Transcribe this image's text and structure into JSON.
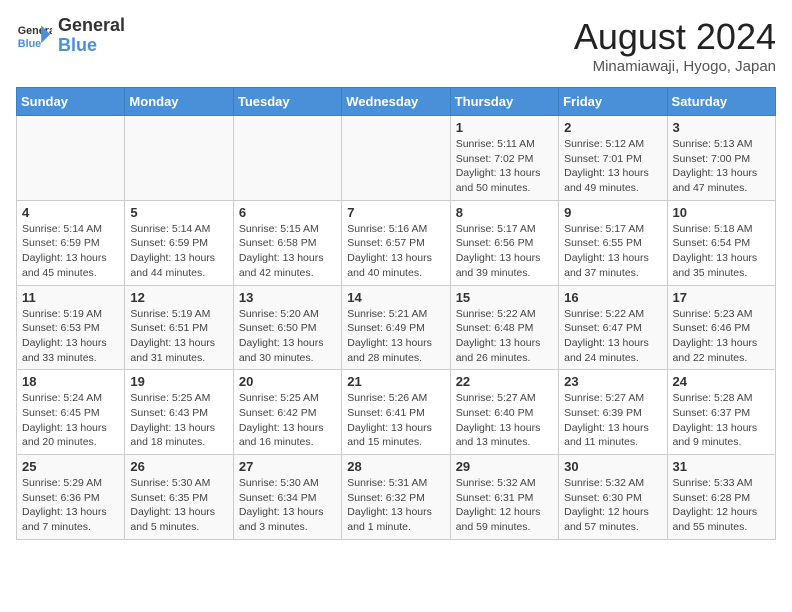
{
  "logo": {
    "line1": "General",
    "line2": "Blue"
  },
  "title": "August 2024",
  "subtitle": "Minamiawaji, Hyogo, Japan",
  "days_of_week": [
    "Sunday",
    "Monday",
    "Tuesday",
    "Wednesday",
    "Thursday",
    "Friday",
    "Saturday"
  ],
  "weeks": [
    [
      {
        "day": "",
        "info": ""
      },
      {
        "day": "",
        "info": ""
      },
      {
        "day": "",
        "info": ""
      },
      {
        "day": "",
        "info": ""
      },
      {
        "day": "1",
        "info": "Sunrise: 5:11 AM\nSunset: 7:02 PM\nDaylight: 13 hours and 50 minutes."
      },
      {
        "day": "2",
        "info": "Sunrise: 5:12 AM\nSunset: 7:01 PM\nDaylight: 13 hours and 49 minutes."
      },
      {
        "day": "3",
        "info": "Sunrise: 5:13 AM\nSunset: 7:00 PM\nDaylight: 13 hours and 47 minutes."
      }
    ],
    [
      {
        "day": "4",
        "info": "Sunrise: 5:14 AM\nSunset: 6:59 PM\nDaylight: 13 hours and 45 minutes."
      },
      {
        "day": "5",
        "info": "Sunrise: 5:14 AM\nSunset: 6:59 PM\nDaylight: 13 hours and 44 minutes."
      },
      {
        "day": "6",
        "info": "Sunrise: 5:15 AM\nSunset: 6:58 PM\nDaylight: 13 hours and 42 minutes."
      },
      {
        "day": "7",
        "info": "Sunrise: 5:16 AM\nSunset: 6:57 PM\nDaylight: 13 hours and 40 minutes."
      },
      {
        "day": "8",
        "info": "Sunrise: 5:17 AM\nSunset: 6:56 PM\nDaylight: 13 hours and 39 minutes."
      },
      {
        "day": "9",
        "info": "Sunrise: 5:17 AM\nSunset: 6:55 PM\nDaylight: 13 hours and 37 minutes."
      },
      {
        "day": "10",
        "info": "Sunrise: 5:18 AM\nSunset: 6:54 PM\nDaylight: 13 hours and 35 minutes."
      }
    ],
    [
      {
        "day": "11",
        "info": "Sunrise: 5:19 AM\nSunset: 6:53 PM\nDaylight: 13 hours and 33 minutes."
      },
      {
        "day": "12",
        "info": "Sunrise: 5:19 AM\nSunset: 6:51 PM\nDaylight: 13 hours and 31 minutes."
      },
      {
        "day": "13",
        "info": "Sunrise: 5:20 AM\nSunset: 6:50 PM\nDaylight: 13 hours and 30 minutes."
      },
      {
        "day": "14",
        "info": "Sunrise: 5:21 AM\nSunset: 6:49 PM\nDaylight: 13 hours and 28 minutes."
      },
      {
        "day": "15",
        "info": "Sunrise: 5:22 AM\nSunset: 6:48 PM\nDaylight: 13 hours and 26 minutes."
      },
      {
        "day": "16",
        "info": "Sunrise: 5:22 AM\nSunset: 6:47 PM\nDaylight: 13 hours and 24 minutes."
      },
      {
        "day": "17",
        "info": "Sunrise: 5:23 AM\nSunset: 6:46 PM\nDaylight: 13 hours and 22 minutes."
      }
    ],
    [
      {
        "day": "18",
        "info": "Sunrise: 5:24 AM\nSunset: 6:45 PM\nDaylight: 13 hours and 20 minutes."
      },
      {
        "day": "19",
        "info": "Sunrise: 5:25 AM\nSunset: 6:43 PM\nDaylight: 13 hours and 18 minutes."
      },
      {
        "day": "20",
        "info": "Sunrise: 5:25 AM\nSunset: 6:42 PM\nDaylight: 13 hours and 16 minutes."
      },
      {
        "day": "21",
        "info": "Sunrise: 5:26 AM\nSunset: 6:41 PM\nDaylight: 13 hours and 15 minutes."
      },
      {
        "day": "22",
        "info": "Sunrise: 5:27 AM\nSunset: 6:40 PM\nDaylight: 13 hours and 13 minutes."
      },
      {
        "day": "23",
        "info": "Sunrise: 5:27 AM\nSunset: 6:39 PM\nDaylight: 13 hours and 11 minutes."
      },
      {
        "day": "24",
        "info": "Sunrise: 5:28 AM\nSunset: 6:37 PM\nDaylight: 13 hours and 9 minutes."
      }
    ],
    [
      {
        "day": "25",
        "info": "Sunrise: 5:29 AM\nSunset: 6:36 PM\nDaylight: 13 hours and 7 minutes."
      },
      {
        "day": "26",
        "info": "Sunrise: 5:30 AM\nSunset: 6:35 PM\nDaylight: 13 hours and 5 minutes."
      },
      {
        "day": "27",
        "info": "Sunrise: 5:30 AM\nSunset: 6:34 PM\nDaylight: 13 hours and 3 minutes."
      },
      {
        "day": "28",
        "info": "Sunrise: 5:31 AM\nSunset: 6:32 PM\nDaylight: 13 hours and 1 minute."
      },
      {
        "day": "29",
        "info": "Sunrise: 5:32 AM\nSunset: 6:31 PM\nDaylight: 12 hours and 59 minutes."
      },
      {
        "day": "30",
        "info": "Sunrise: 5:32 AM\nSunset: 6:30 PM\nDaylight: 12 hours and 57 minutes."
      },
      {
        "day": "31",
        "info": "Sunrise: 5:33 AM\nSunset: 6:28 PM\nDaylight: 12 hours and 55 minutes."
      }
    ]
  ]
}
